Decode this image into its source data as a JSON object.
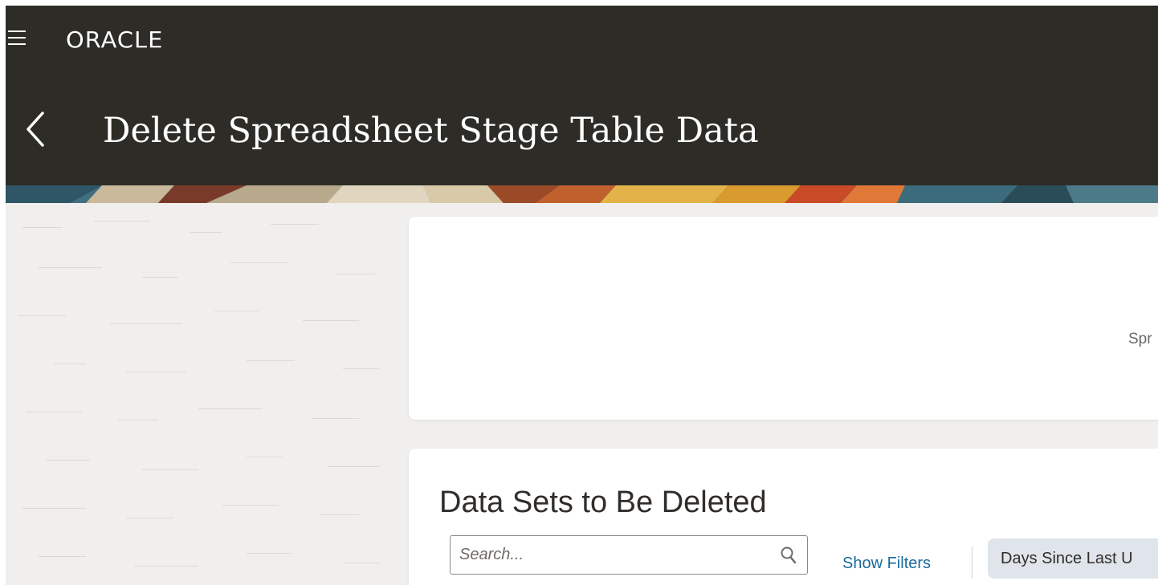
{
  "app": {
    "brand": "ORACLE",
    "page_title": "Delete Spreadsheet Stage Table Data"
  },
  "info_card": {
    "partial_text": "Spr"
  },
  "data_sets": {
    "title": "Data Sets to Be Deleted",
    "search_placeholder": "Search...",
    "show_filters_label": "Show Filters",
    "filter_chip_label": "Days Since Last U"
  },
  "icons": {
    "menu": "hamburger-icon",
    "back": "chevron-left-icon",
    "search": "search-icon"
  },
  "colors": {
    "header_bg": "#2d2c27",
    "link": "#1b6a9c",
    "chip_bg": "#dfe5ea",
    "page_bg": "#f1efed"
  }
}
